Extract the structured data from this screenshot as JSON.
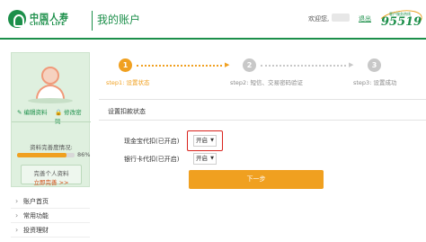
{
  "header": {
    "brand_cn": "中国人寿",
    "brand_en": "CHINA LIFE",
    "account_title": "我的账户",
    "welcome_text": "欢迎您,",
    "logout_label": "退出",
    "hotline_caption": "客户服务热线",
    "hotline_number": "95519"
  },
  "sidebar": {
    "edit_profile_label": "编辑资料",
    "change_password_label": "修改密码",
    "completeness_label": "资料完善度情况:",
    "completeness_percent": 86,
    "completeness_text": "86%",
    "complete_info_line1": "完善个人资料",
    "complete_info_line2": "立即完善 >>",
    "nav_items": [
      {
        "label": "账户首页"
      },
      {
        "label": "常用功能"
      },
      {
        "label": "投资理财"
      }
    ]
  },
  "steps": [
    {
      "number": "1",
      "label": "step1: 设置状态",
      "active": true
    },
    {
      "number": "2",
      "label": "step2: 短信、交易密码验证",
      "active": false
    },
    {
      "number": "3",
      "label": "step3: 设置成功",
      "active": false
    }
  ],
  "panel": {
    "title": "设置扣款状态",
    "rows": [
      {
        "label": "现金宝代扣(已开启)",
        "value": "开启"
      },
      {
        "label": "银行卡代扣(已开启)",
        "value": "开启"
      }
    ],
    "next_label": "下一步"
  },
  "colors": {
    "brand_green": "#1c8f4a",
    "accent_orange": "#f0a020",
    "highlight_red": "#d9231d"
  }
}
